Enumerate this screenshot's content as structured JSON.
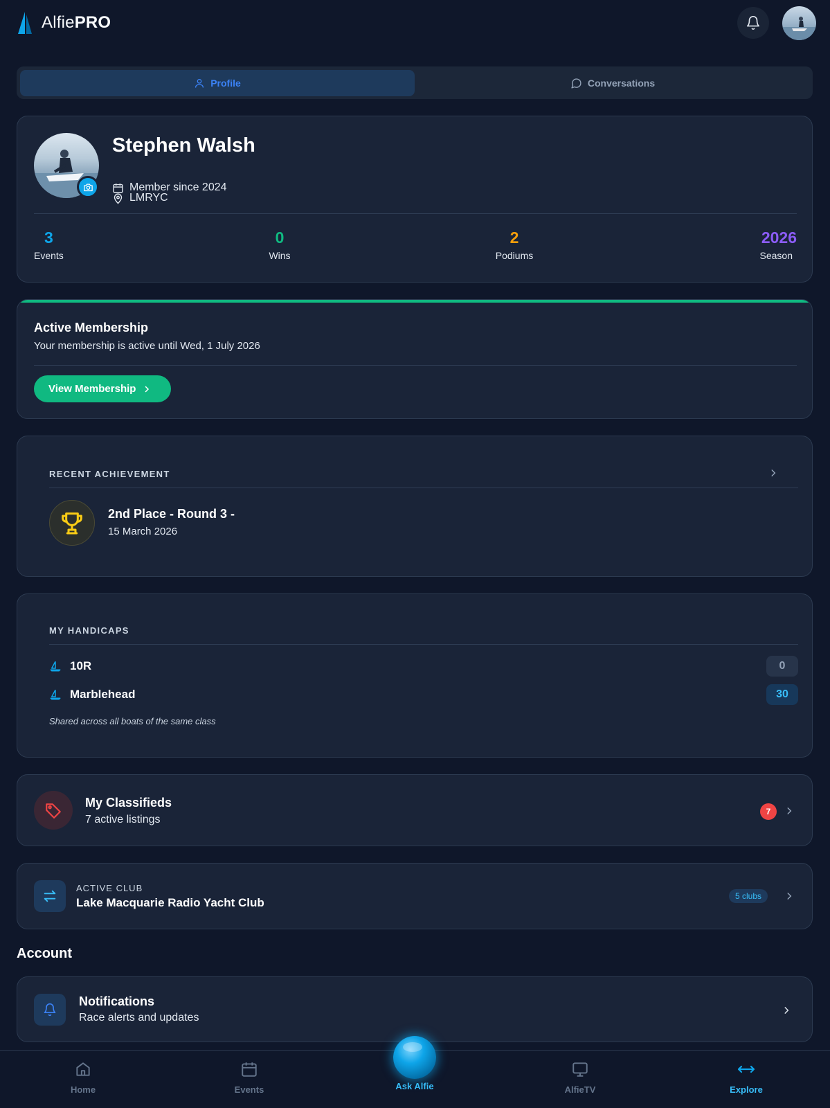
{
  "app": {
    "name_regular": "Alfie",
    "name_bold": "PRO"
  },
  "tabs": [
    {
      "label": "Profile",
      "icon": "user-icon",
      "active": true
    },
    {
      "label": "Conversations",
      "icon": "chat-bubble-icon",
      "active": false
    }
  ],
  "profile": {
    "name": "Stephen Walsh",
    "club": "LMRYC",
    "member_since": "Member since 2024",
    "stats": [
      {
        "value": "3",
        "label": "Events",
        "color": "#0ea5e9"
      },
      {
        "value": "0",
        "label": "Wins",
        "color": "#10b981"
      },
      {
        "value": "2",
        "label": "Podiums",
        "color": "#f59e0b"
      },
      {
        "value": "2026",
        "label": "Season",
        "color": "#8b5cf6"
      }
    ]
  },
  "membership": {
    "title": "Active Membership",
    "subtitle": "Your membership is active until Wed, 1 July 2026",
    "button": "View Membership"
  },
  "achievement": {
    "label": "RECENT ACHIEVEMENT",
    "title": "2nd Place - Round 3 -",
    "date": "15 March 2026"
  },
  "handicaps": {
    "label": "MY HANDICAPS",
    "items": [
      {
        "name": "10R",
        "value": "0",
        "bg": "#27344a",
        "color": "#94a3b8"
      },
      {
        "name": "Marblehead",
        "value": "30",
        "bg": "#17385a",
        "color": "#38bdf8"
      }
    ],
    "note": "Shared across all boats of the same class"
  },
  "classifieds": {
    "title": "My Classifieds",
    "subtitle": "7 active listings",
    "badge": "7"
  },
  "club": {
    "label": "ACTIVE CLUB",
    "name": "Lake Macquarie Radio Yacht Club",
    "pill": "5 clubs"
  },
  "account": {
    "heading": "Account",
    "notifications": {
      "title": "Notifications",
      "subtitle": "Race alerts and updates"
    }
  },
  "bottom_nav": [
    {
      "label": "Home",
      "icon": "home-icon"
    },
    {
      "label": "Events",
      "icon": "calendar-icon"
    },
    {
      "label": "Ask Alfie",
      "icon": "orb-icon",
      "active": true
    },
    {
      "label": "AlfieTV",
      "icon": "tv-icon"
    },
    {
      "label": "Explore",
      "icon": "arrows-horizontal-icon",
      "active": true
    }
  ]
}
